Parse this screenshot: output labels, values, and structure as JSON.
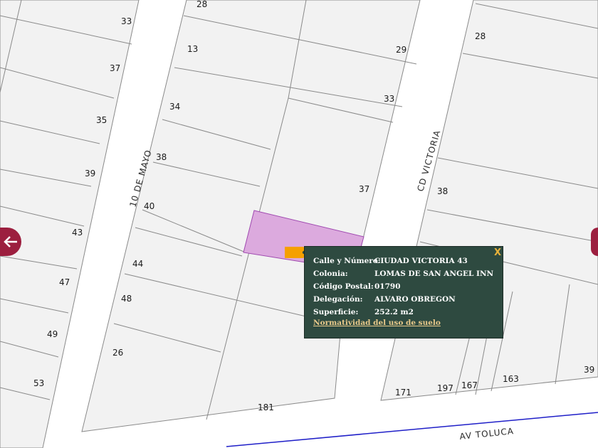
{
  "map": {
    "streets": {
      "diez_de_mayo": "10 DE MAYO",
      "cd_victoria": "CD VICTORIA",
      "av_toluca": "AV TOLUCA"
    },
    "lot_numbers": {
      "n28a": "28",
      "n33a": "33",
      "n13": "13",
      "n29": "29",
      "n28b": "28",
      "n37a": "37",
      "n34": "34",
      "n33b": "33",
      "n35": "35",
      "n38a": "38",
      "n39a": "39",
      "n37b": "37",
      "n40": "40",
      "n38b": "38",
      "n43": "43",
      "n44": "44",
      "n47": "47",
      "n48": "48",
      "n49": "49",
      "n26": "26",
      "n53": "53",
      "n181": "181",
      "n171": "171",
      "n197": "197",
      "n167": "167",
      "n163": "163",
      "n39b": "39"
    },
    "colors": {
      "selected_parcel": "#dcaade",
      "parcel_line": "#8a8a8a",
      "road": "#ffffff",
      "block": "#f2f2f2",
      "toluca_line": "#1f1fc8",
      "popup_bg": "#2e4a40",
      "nav_arrow": "#9c1f3f",
      "pin": "#f5a000"
    }
  },
  "popup": {
    "close": "X",
    "rows": [
      {
        "label": "Calle y Número:",
        "value": "CIUDAD VICTORIA 43"
      },
      {
        "label": "Colonia:",
        "value": "LOMAS DE SAN ANGEL INN"
      },
      {
        "label": "Código Postal:",
        "value": "01790"
      },
      {
        "label": "Delegación:",
        "value": "ALVARO OBREGON"
      },
      {
        "label": "Superficie:",
        "value": "252.2 m2"
      }
    ],
    "link": "Normatividad del uso de suelo"
  },
  "navigation": {
    "left_icon": "arrow-left-icon",
    "right_icon": "arrow-right-icon"
  }
}
